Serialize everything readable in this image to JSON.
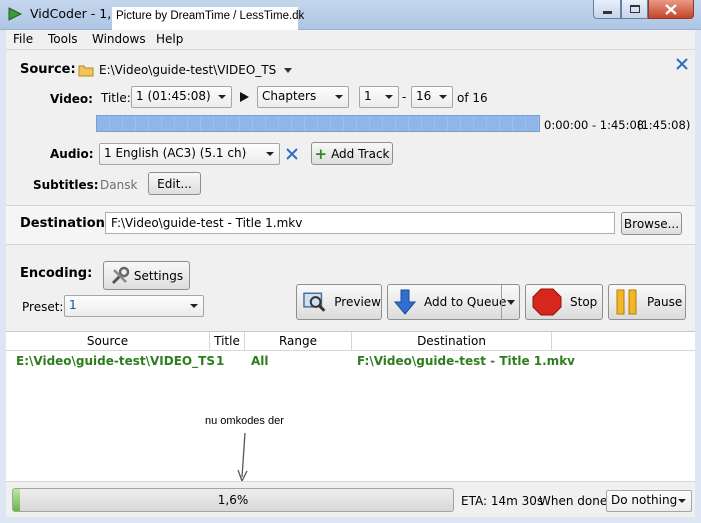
{
  "window": {
    "title": "VidCoder - 1,6%",
    "overlay_caption": "Picture by DreamTime / LessTime.dk"
  },
  "menu": [
    "File",
    "Tools",
    "Windows",
    "Help"
  ],
  "source": {
    "label": "Source:",
    "path": "E:\\Video\\guide-test\\VIDEO_TS"
  },
  "video": {
    "label": "Video:",
    "title_label": "Title:",
    "title_value": "1 (01:45:08)",
    "range_type": "Chapters",
    "chapter_start": "1",
    "separator": "-",
    "chapter_end": "16",
    "of_label": "of 16",
    "time_range": "0:00:00 - 1:45:08",
    "duration": "(1:45:08)"
  },
  "audio": {
    "label": "Audio:",
    "track": "1 English (AC3) (5.1 ch)",
    "add_track": "Add Track"
  },
  "subtitles": {
    "label": "Subtitles:",
    "value": "Dansk",
    "edit": "Edit..."
  },
  "destination": {
    "label": "Destination:",
    "path": "F:\\Video\\guide-test - Title 1.mkv",
    "browse": "Browse..."
  },
  "encoding": {
    "label": "Encoding:",
    "settings": "Settings",
    "preset_label": "Preset:",
    "preset_value": "1",
    "preview": "Preview",
    "add_to_queue": "Add to Queue",
    "stop": "Stop",
    "pause": "Pause"
  },
  "queue": {
    "columns": [
      "Source",
      "Title",
      "Range",
      "Destination"
    ],
    "rows": [
      {
        "source": "E:\\Video\\guide-test\\VIDEO_TS",
        "title": "1",
        "range": "All",
        "destination": "F:\\Video\\guide-test - Title 1.mkv"
      }
    ],
    "annotation": "nu omkodes der"
  },
  "status": {
    "progress_text": "1,6%",
    "progress_value": 0.016,
    "eta": "ETA: 14m 30s",
    "when_done_label": "When done:",
    "when_done_value": "Do nothing"
  },
  "colors": {
    "queue_text": "#2e7d1e",
    "accent_blue": "#8fb6e8",
    "progress_green": "#68b845"
  }
}
